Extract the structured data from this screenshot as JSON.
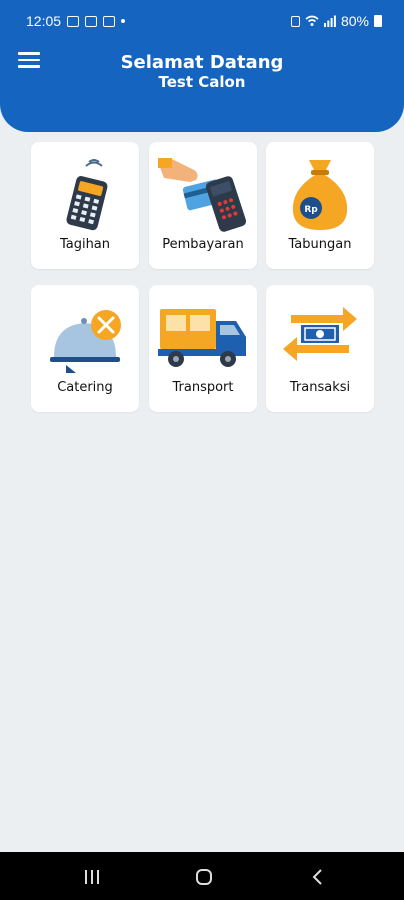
{
  "status_bar": {
    "time": "12:05",
    "battery": "80%"
  },
  "header": {
    "title": "Selamat Datang",
    "subtitle": "Test Calon"
  },
  "menu": [
    {
      "label": "Tagihan",
      "icon": "calculator-icon"
    },
    {
      "label": "Pembayaran",
      "icon": "card-payment-icon"
    },
    {
      "label": "Tabungan",
      "icon": "money-bag-icon"
    },
    {
      "label": "Catering",
      "icon": "food-cloche-icon"
    },
    {
      "label": "Transport",
      "icon": "truck-icon"
    },
    {
      "label": "Transaksi",
      "icon": "exchange-icon"
    }
  ],
  "colors": {
    "header": "#1565C0",
    "background": "#ECEFF1",
    "accent": "#F5A623"
  }
}
